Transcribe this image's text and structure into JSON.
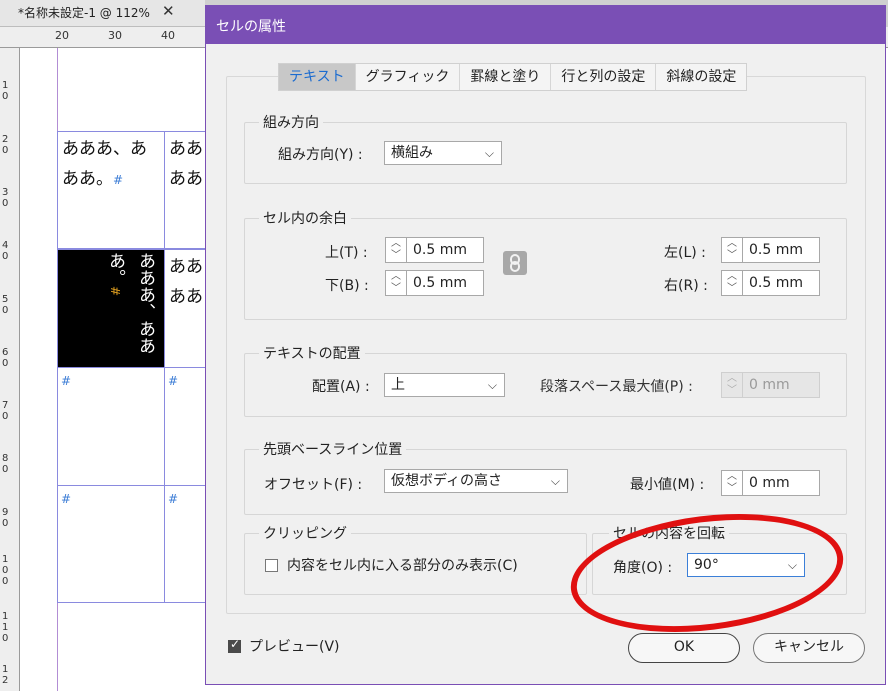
{
  "document": {
    "tab_title": "*名称未設定-1 @ 112%",
    "close_glyph": "✕",
    "hruler_labels": [
      "20",
      "30",
      "40"
    ],
    "vruler_labels": [
      "1\n0",
      "2\n0",
      "3\n0",
      "4\n0",
      "5\n0",
      "6\n0",
      "7\n0",
      "8\n0",
      "9\n0",
      "1\n0\n0",
      "1\n1\n0",
      "1\n2"
    ],
    "cells": {
      "r1c1_text": "あああ、あ ああ。",
      "r1c2_text": "ああ ああ",
      "r2c1_text": "あああ、ああ あ。",
      "r2c2_text": "ああ ああ",
      "hash": "#"
    }
  },
  "dialog": {
    "title": "セルの属性",
    "tabs": [
      "テキスト",
      "グラフィック",
      "罫線と塗り",
      "行と列の設定",
      "斜線の設定"
    ],
    "active_tab": "テキスト",
    "direction": {
      "title": "組み方向",
      "label": "組み方向(Y) :",
      "value": "横組み"
    },
    "inset": {
      "title": "セル内の余白",
      "top_label": "上(T) :",
      "top_value": "0.5 mm",
      "bottom_label": "下(B) :",
      "bottom_value": "0.5 mm",
      "left_label": "左(L) :",
      "left_value": "0.5 mm",
      "right_label": "右(R) :",
      "right_value": "0.5 mm"
    },
    "alignment": {
      "title": "テキストの配置",
      "label": "配置(A) :",
      "value": "上",
      "para_spacing_label": "段落スペース最大値(P) :",
      "para_spacing_value": "0 mm"
    },
    "baseline": {
      "title": "先頭ベースライン位置",
      "offset_label": "オフセット(F) :",
      "offset_value": "仮想ボディの高さ",
      "min_label": "最小値(M) :",
      "min_value": "0 mm"
    },
    "clipping": {
      "title": "クリッピング",
      "checkbox_label": "内容をセル内に入る部分のみ表示(C)",
      "checked": false
    },
    "rotation": {
      "title": "セルの内容を回転",
      "label": "角度(O) :",
      "value": "90°"
    },
    "preview": {
      "label": "プレビュー(V)",
      "checked": true
    },
    "ok_label": "OK",
    "cancel_label": "キャンセル"
  },
  "colors": {
    "titlebar": "#7a4fb5",
    "active_tab_text": "#1a6bd0",
    "highlight_ellipse": "#e01010"
  }
}
